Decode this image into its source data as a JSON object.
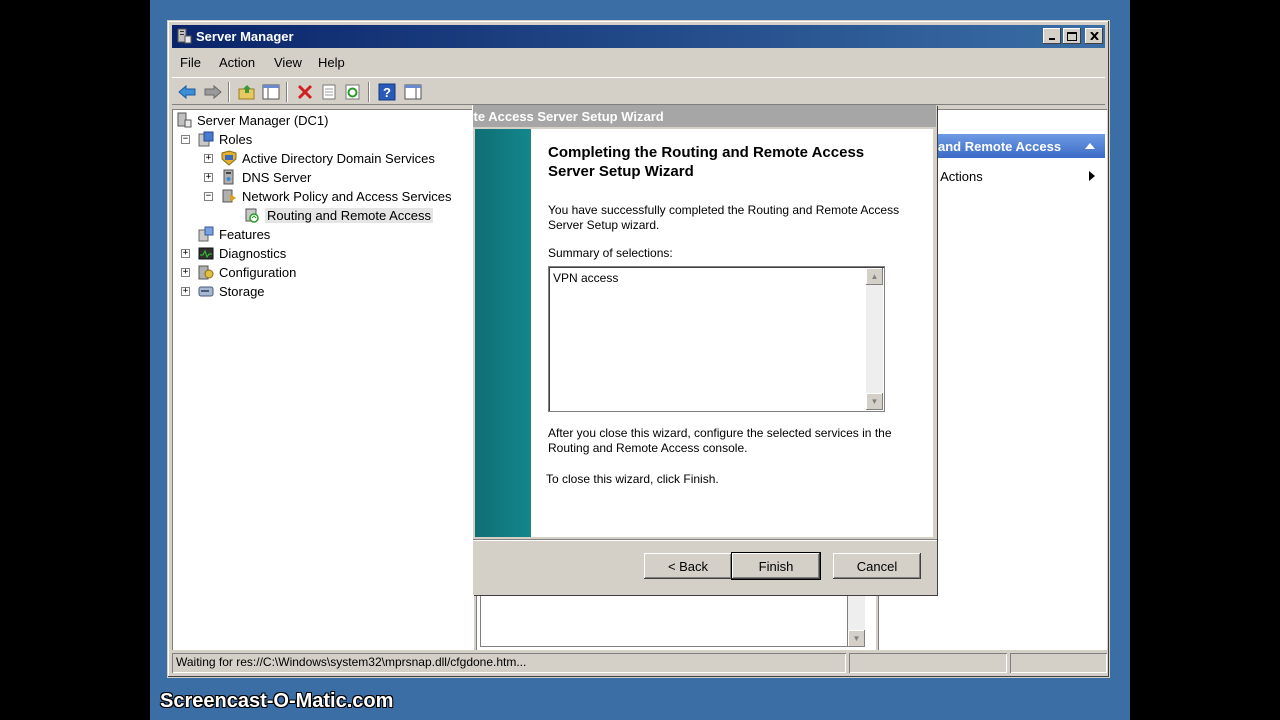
{
  "window": {
    "title": "Server Manager"
  },
  "menu": [
    "File",
    "Action",
    "View",
    "Help"
  ],
  "toolbar": {
    "icons": [
      "back-arrow-icon",
      "forward-arrow-icon",
      "up-folder-icon",
      "show-hide-tree-icon",
      "delete-icon",
      "properties-icon",
      "refresh-icon",
      "help-icon",
      "show-hide-action-pane-icon"
    ]
  },
  "tree": {
    "root": "Server Manager (DC1)",
    "roles": "Roles",
    "adds": "Active Directory Domain Services",
    "dns": "DNS Server",
    "npas": "Network Policy and Access Services",
    "rras": "Routing and Remote Access",
    "features": "Features",
    "diagnostics": "Diagnostics",
    "configuration": "Configuration",
    "storage": "Storage"
  },
  "actions": {
    "header": "and Remote Access",
    "more": "e Actions"
  },
  "wizard": {
    "title": "Routing and Remote Access Server Setup Wizard",
    "heading": "Completing the Routing and Remote Access Server Setup Wizard",
    "success_text": "You have successfully completed the Routing and Remote Access Server Setup wizard.",
    "summary_label": "Summary of selections:",
    "summary_value": "VPN access",
    "after_text": "After you close this wizard, configure the selected services in the Routing and  Remote Access console.",
    "close_text": "To close this wizard, click Finish.",
    "back_label": "< Back",
    "finish_label": "Finish",
    "cancel_label": "Cancel"
  },
  "status": {
    "text": "Waiting for res://C:\\Windows\\system32\\mprsnap.dll/cfgdone.htm..."
  },
  "watermark": "Screencast-O-Matic.com"
}
